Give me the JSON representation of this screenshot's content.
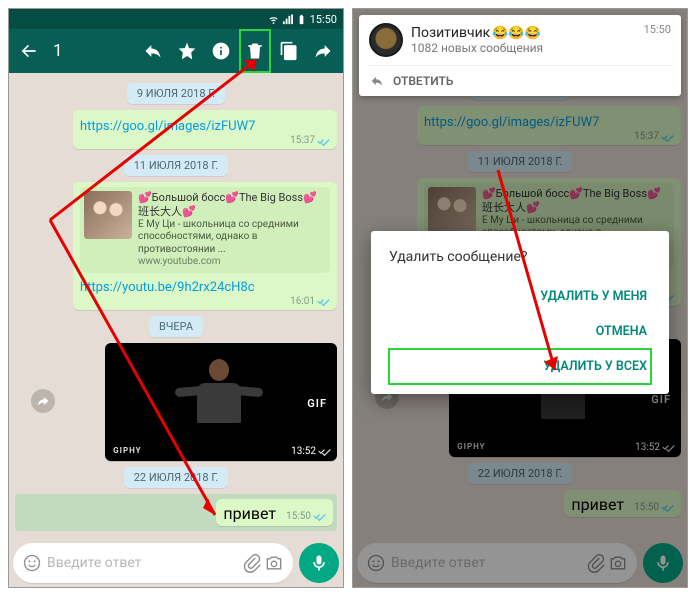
{
  "status": {
    "time": "15:50"
  },
  "actionbar": {
    "count": "1"
  },
  "dates": {
    "d1": "9 ИЮЛЯ 2018 Г.",
    "d2": "11 ИЮЛЯ 2018 Г.",
    "d3": "ВЧЕРА",
    "d4": "22 ИЮЛЯ 2018 Г."
  },
  "msgs": {
    "link1": {
      "text": "https://goo.gl/images/izFUW7",
      "time": "15:37"
    },
    "preview": {
      "title_pre": "💕Большой босс💕The Big Boss💕班长大人💕",
      "desc": "Е Му Ци - школьница со средними способностями, однако в противостоянии ...",
      "domain": "www.youtube.com",
      "link": "https://youtu.be/9h2rx24cH8c",
      "time": "16:01"
    },
    "gif": {
      "tag": "GIF",
      "source": "GIPHY",
      "time": "13:52"
    },
    "hello": {
      "text": "привет",
      "time": "15:50"
    }
  },
  "input": {
    "placeholder": "Введите ответ"
  },
  "notif": {
    "title": "Позитивчик",
    "emoji": "😂😂😂",
    "sub": "1082 новых сообщения",
    "time": "15:50",
    "reply": "ОТВЕТИТЬ"
  },
  "dialog": {
    "title": "Удалить сообщение?",
    "del_me": "УДАЛИТЬ У МЕНЯ",
    "cancel": "ОТМЕНА",
    "del_all": "УДАЛИТЬ У ВСЕХ"
  }
}
